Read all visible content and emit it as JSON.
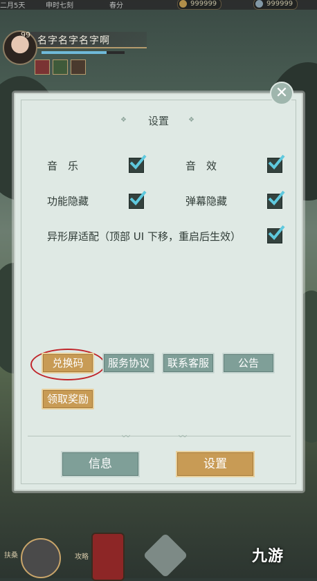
{
  "topbar": {
    "date_text": "二月5天",
    "time_text": "申时七刻",
    "season_text": "春分",
    "currency_1": "999999",
    "currency_2": "999999"
  },
  "profile": {
    "level": "99",
    "name": "名字名字名字啊",
    "hp_fraction": 0.78
  },
  "dialog": {
    "title": "设置",
    "options": {
      "music": {
        "label": "音　乐",
        "checked": true
      },
      "sound": {
        "label": "音　效",
        "checked": true
      },
      "hide_function": {
        "label": "功能隐藏",
        "checked": true
      },
      "hide_danmaku": {
        "label": "弹幕隐藏",
        "checked": true
      },
      "notch_adapt": {
        "label": "异形屏适配（顶部 UI 下移，重启后生效）",
        "checked": true
      }
    },
    "actions": {
      "redeem": "兑换码",
      "agreement": "服务协议",
      "support": "联系客服",
      "notice": "公告",
      "claim": "领取奖励"
    },
    "nav": {
      "info": "信息",
      "settings": "设置"
    }
  },
  "bottom": {
    "left_label": "扶桑",
    "mid_label": "攻略"
  },
  "watermark": "九游",
  "colors": {
    "accent_gold": "#c89b55",
    "accent_teal": "#7f9f98",
    "highlight_ring": "#c0252a",
    "panel_bg": "#dfe9e4"
  }
}
